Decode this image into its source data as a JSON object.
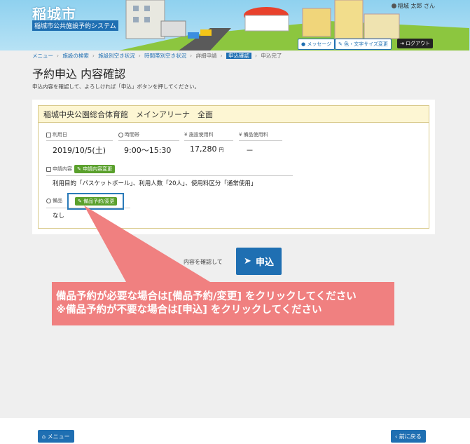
{
  "header": {
    "title": "稲城市",
    "subtitle": "稲城市公共施設予約システム",
    "user": "稲城 太郎 さん",
    "message_btn": "メッセージ",
    "font_size_btn": "色・文字サイズ変更",
    "logout_btn": "ログアウト"
  },
  "breadcrumb": {
    "items": [
      "メニュー",
      "施設の検索",
      "施設別空き状況",
      "時間帯別空き状況",
      "詳細申請",
      "申込確認",
      "申込完了"
    ]
  },
  "page": {
    "title": "予約申込 内容確認",
    "description": "申込内容を確認して、よろしければ「申込」ボタンを押してください。"
  },
  "card": {
    "facility": "稲城中央公園総合体育館　メインアリーナ　全面",
    "labels": {
      "date": "利用日",
      "time": "時間帯",
      "fee": "施設使用料",
      "equip_fee": "備品使用料",
      "content": "申請内容",
      "equipment": "備品"
    },
    "values": {
      "date": "2019/10/5(土)",
      "time": "9:00～15:30",
      "fee": "17,280",
      "fee_unit": "円",
      "equip_fee": "－",
      "content": "利用目的「バスケットボール」、利用人数「20人」、使用料区分「通常使用」",
      "equipment": "なし"
    },
    "content_change_btn": "申請内容変更",
    "equip_change_btn": "備品予約/変更"
  },
  "confirm": {
    "text": "内容を確認して",
    "submit_label": "申込"
  },
  "callout": {
    "line1": "備品予約が必要な場合は[備品予約/変更] をクリックしてください",
    "line2": "※備品予約が不要な場合は[申込] をクリックしてください"
  },
  "footer": {
    "menu_btn": "メニュー",
    "back_btn": "前に戻る"
  },
  "colors": {
    "primary": "#1f6fb2",
    "tag_green": "#5aa02c",
    "callout": "#f08080",
    "card_head": "#fdf6d3"
  }
}
